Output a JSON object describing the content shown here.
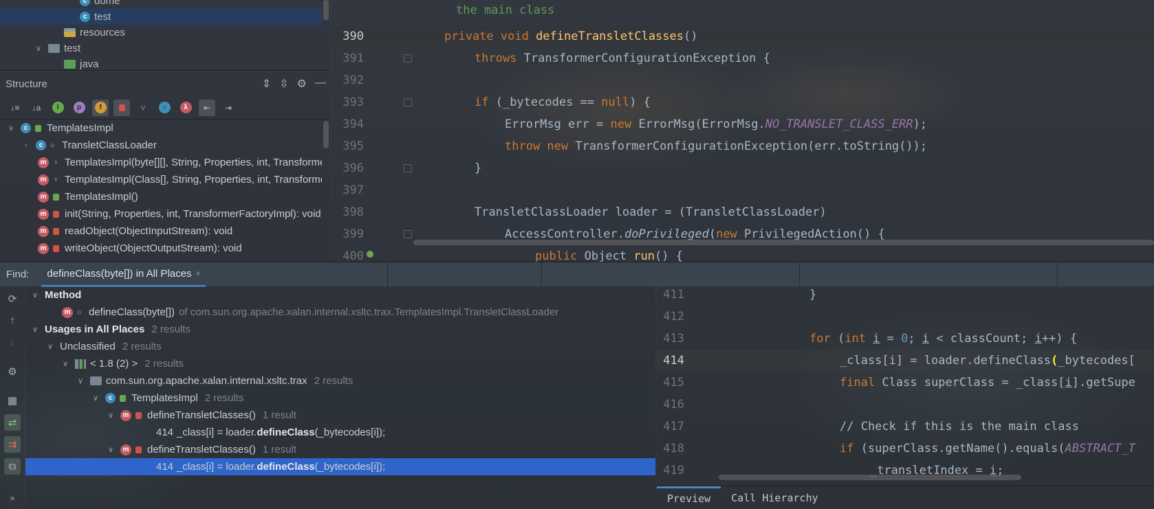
{
  "project_tree": {
    "items": [
      {
        "label": "dome",
        "type": "class"
      },
      {
        "label": "test",
        "type": "class",
        "selected": true
      },
      {
        "label": "resources",
        "type": "resources-folder"
      },
      {
        "label": "test",
        "type": "folder"
      },
      {
        "label": "java",
        "type": "java-folder"
      }
    ]
  },
  "structure": {
    "title": "Structure",
    "root": "TemplatesImpl",
    "items": [
      {
        "label": "TransletClassLoader",
        "kind": "class"
      },
      {
        "label": "TemplatesImpl(byte[][], String, Properties, int, TransformerFactoryImpl)",
        "kind": "method"
      },
      {
        "label": "TemplatesImpl(Class[], String, Properties, int, TransformerFactoryImpl)",
        "kind": "method"
      },
      {
        "label": "TemplatesImpl()",
        "kind": "method"
      },
      {
        "label": "init(String, Properties, int, TransformerFactoryImpl): void",
        "kind": "method"
      },
      {
        "label": "readObject(ObjectInputStream): void",
        "kind": "method"
      },
      {
        "label": "writeObject(ObjectOutputStream): void",
        "kind": "method"
      }
    ]
  },
  "editor": {
    "doc_comment": "the main class",
    "lines": [
      {
        "n": "390",
        "current": true
      },
      {
        "n": "391"
      },
      {
        "n": "392"
      },
      {
        "n": "393"
      },
      {
        "n": "394"
      },
      {
        "n": "395"
      },
      {
        "n": "396"
      },
      {
        "n": "397"
      },
      {
        "n": "398"
      },
      {
        "n": "399"
      },
      {
        "n": "400"
      }
    ]
  },
  "find": {
    "label": "Find:",
    "tab_label": "defineClass(byte[]) in All Places",
    "close": "×"
  },
  "results": {
    "method_header": "Method",
    "method_name": "defineClass(byte[])",
    "method_location": "of com.sun.org.apache.xalan.internal.xsltc.trax.TemplatesImpl.TransletClassLoader",
    "usages_label": "Usages in All Places",
    "usages_count": "2 results",
    "unclassified_label": "Unclassified",
    "unclassified_count": "2 results",
    "lib_label": "< 1.8 (2) >",
    "lib_count": "2 results",
    "package_label": "com.sun.org.apache.xalan.internal.xsltc.trax",
    "package_count": "2 results",
    "class_label": "TemplatesImpl",
    "class_count": "2 results",
    "method1_label": "defineTransletClasses()",
    "method1_count": "1 result",
    "usage1_line": "414",
    "usage1_pre": "_class[i] = loader.",
    "usage1_match": "defineClass",
    "usage1_post": "(_bytecodes[i]);",
    "method2_label": "defineTransletClasses()",
    "method2_count": "1 result",
    "usage2_line": "414",
    "usage2_pre": "_class[i] = loader.",
    "usage2_match": "defineClass",
    "usage2_post": "(_bytecodes[i]);"
  },
  "preview": {
    "lines": [
      {
        "n": "411"
      },
      {
        "n": "412"
      },
      {
        "n": "413"
      },
      {
        "n": "414",
        "current": true
      },
      {
        "n": "415"
      },
      {
        "n": "416"
      },
      {
        "n": "417"
      },
      {
        "n": "418"
      },
      {
        "n": "419"
      }
    ],
    "tabs": [
      "Preview",
      "Call Hierarchy"
    ]
  },
  "colors": {
    "keyword": "#cc7832",
    "function": "#ffc66d",
    "constant": "#9876aa",
    "comment": "#808080",
    "selection": "#2f65ca",
    "accent": "#4a88c7"
  }
}
